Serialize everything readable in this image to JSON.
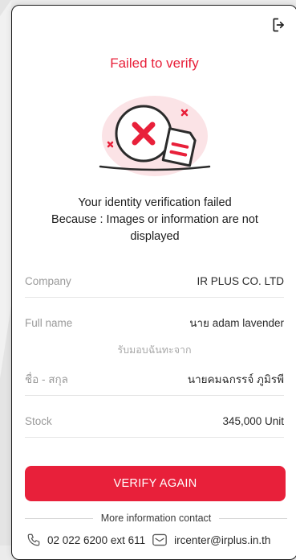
{
  "header": {
    "logout_icon": "logout-icon",
    "title": "Failed to verify"
  },
  "illustration": {
    "icon": "failed-document-icon",
    "accent_color": "#e8203a",
    "blob_color": "#fbe3e6"
  },
  "message": {
    "line1": "Your identity verification failed",
    "line2": "Because : Images or information are not displayed"
  },
  "details": {
    "company_label": "Company",
    "company_value": "IR PLUS CO. LTD",
    "fullname_label": "Full name",
    "fullname_value": "นาย adam lavender",
    "receive_from": "รับมอบฉันทะจาก",
    "thai_name_label": "ชื่อ - สกุล",
    "thai_name_value": "นายคมฉกรรจ์ ภูมิรพี",
    "stock_label": "Stock",
    "stock_value": "345,000 Unit"
  },
  "actions": {
    "verify_again": "VERIFY AGAIN"
  },
  "footer": {
    "more_info": "More information contact",
    "phone": "02 022 6200 ext 611",
    "email": "ircenter@irplus.in.th"
  }
}
